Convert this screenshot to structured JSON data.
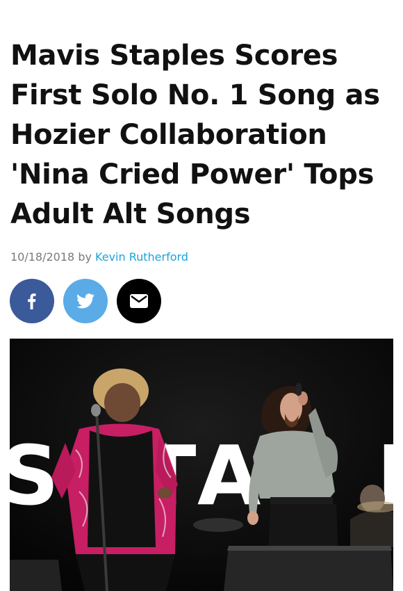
{
  "article": {
    "title": "Mavis Staples Scores First Solo No. 1 Song as Hozier Collaboration 'Nina Cried Power' Tops Adult Alt Songs",
    "date": "10/18/2018",
    "by": "by",
    "author": "Kevin Rutherford"
  },
  "share": {
    "buttons": [
      {
        "name": "facebook",
        "icon": "facebook-icon",
        "color": "#3b5a9a"
      },
      {
        "name": "twitter",
        "icon": "twitter-bird-icon",
        "color": "#5aabe6"
      },
      {
        "name": "email",
        "icon": "envelope-icon",
        "color": "#000000"
      }
    ]
  },
  "photo": {
    "backdrop_letters": [
      "S",
      "T",
      "A",
      "L"
    ]
  }
}
